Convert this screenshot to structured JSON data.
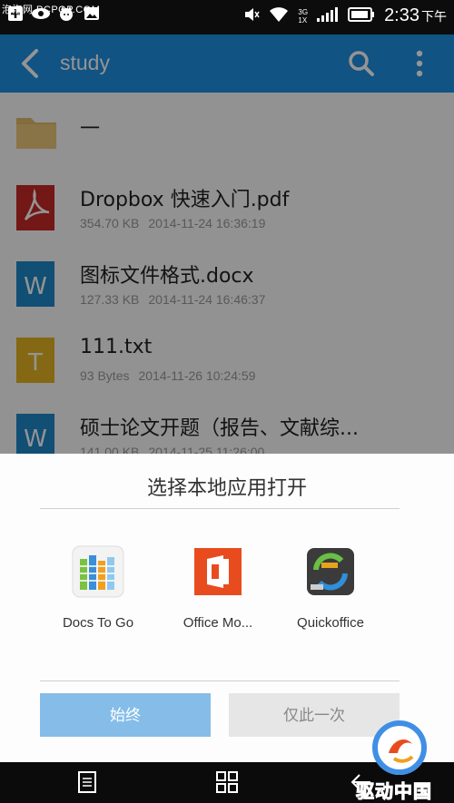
{
  "status_bar": {
    "watermark": "泡泡网 PCPOP.COM",
    "network_top": "3G",
    "network_bottom": "1X",
    "time": "2:33",
    "ampm": "下午"
  },
  "app_bar": {
    "title": "study",
    "icons": [
      "back-icon",
      "search-icon",
      "more-icon"
    ]
  },
  "files": [
    {
      "type": "folder",
      "name": "一",
      "size": "",
      "date": ""
    },
    {
      "type": "pdf",
      "name": "Dropbox 快速入门.pdf",
      "size": "354.70 KB",
      "date": "2014-11-24 16:36:19"
    },
    {
      "type": "docx",
      "name": "图标文件格式.docx",
      "size": "127.33 KB",
      "date": "2014-11-24 16:46:37"
    },
    {
      "type": "txt",
      "name": "111.txt",
      "size": "93 Bytes",
      "date": "2014-11-26 10:24:59"
    },
    {
      "type": "docx",
      "name": "硕士论文开题（报告、文献综...",
      "size": "141.00 KB",
      "date": "2014-11-25 11:26:00"
    }
  ],
  "dialog": {
    "title": "选择本地应用打开",
    "apps": [
      {
        "label": "Docs To Go",
        "icon": "docs-to-go-icon"
      },
      {
        "label": "Office Mo...",
        "icon": "office-mobile-icon"
      },
      {
        "label": "Quickoffice",
        "icon": "quickoffice-icon"
      }
    ],
    "always_label": "始终",
    "once_label": "仅此一次"
  },
  "logo": {
    "text": "驱动中国"
  },
  "colors": {
    "accent": "#1e8fe0",
    "pdf": "#c62828",
    "docx": "#1e88c9",
    "txt": "#e6b422",
    "folder": "#e2bb6a",
    "office": "#e84c1e"
  }
}
